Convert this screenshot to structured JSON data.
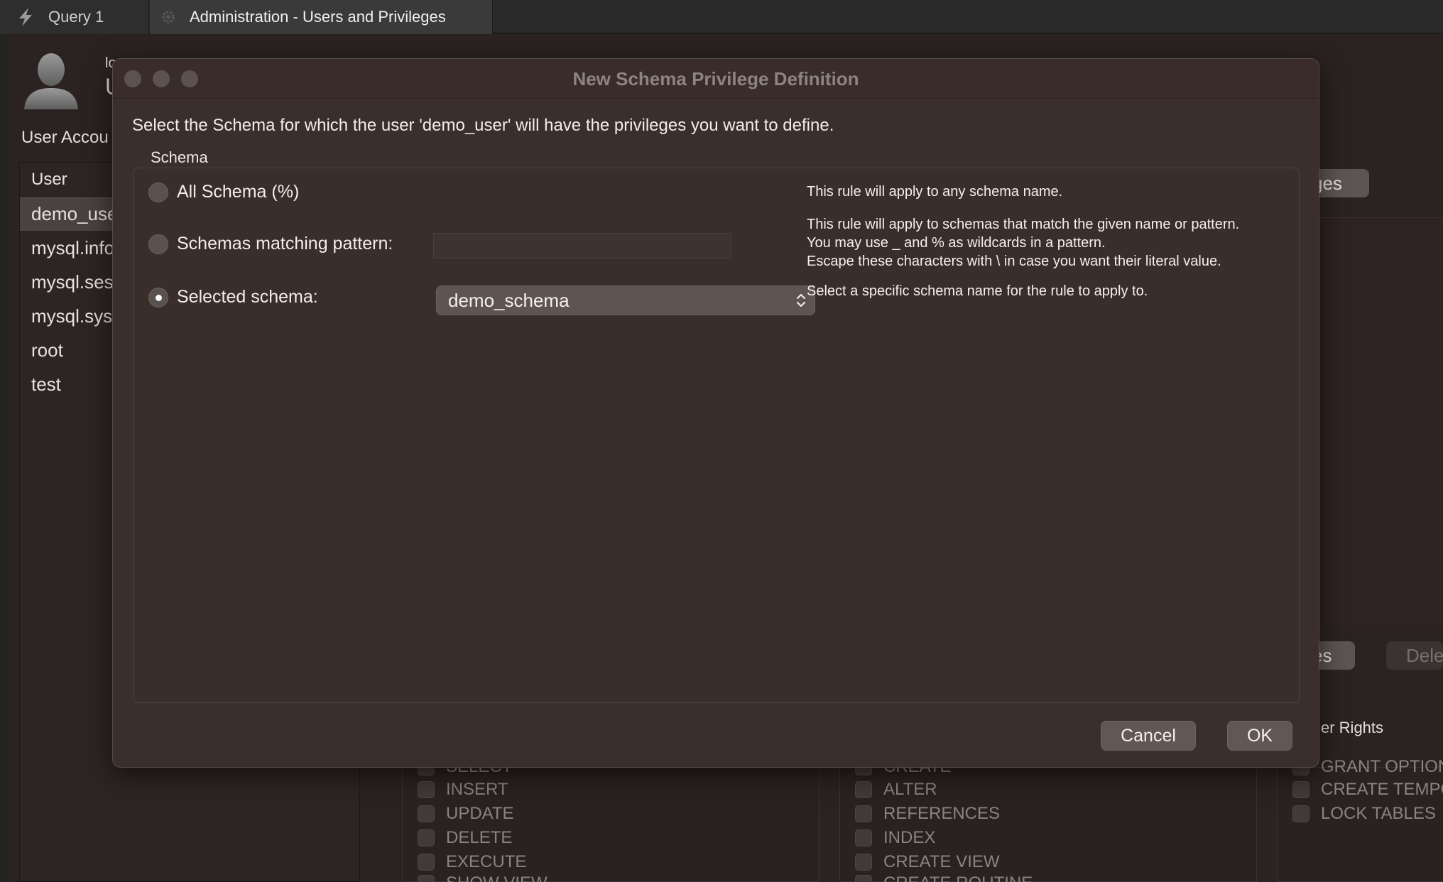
{
  "tabs": [
    {
      "label": "Query 1"
    },
    {
      "label": "Administration - Users and Privileges"
    }
  ],
  "background": {
    "login_label_partial": "lo",
    "login_value_partial": "U",
    "section_label_partial": "User Accou",
    "user_list": {
      "header": "User",
      "rows": [
        "demo_use",
        "mysql.info",
        "mysql.ses",
        "mysql.sys",
        "root",
        "test"
      ],
      "selected_index": 0
    },
    "tab_partial": "ges",
    "revoke_button_partial": "es",
    "delete_button_partial": "Dele",
    "other_rights_partial": "er Rights",
    "object_rights": [
      "SELECT",
      "INSERT",
      "UPDATE",
      "DELETE",
      "EXECUTE",
      "SHOW VIEW"
    ],
    "ddl_rights": [
      "CREATE",
      "ALTER",
      "REFERENCES",
      "INDEX",
      "CREATE VIEW",
      "CREATE ROUTINE"
    ],
    "other_rights": [
      "GRANT OPTION",
      "CREATE TEMPO",
      "LOCK TABLES"
    ]
  },
  "dialog": {
    "title": "New Schema Privilege Definition",
    "instruction": "Select the Schema for which the user 'demo_user' will have the privileges you want to define.",
    "group_label": "Schema",
    "options": {
      "all": {
        "label": "All Schema (%)",
        "selected": false,
        "description": "This rule will apply to any schema name."
      },
      "pattern": {
        "label": "Schemas matching pattern:",
        "selected": false,
        "value": "",
        "description_lines": [
          "This rule will apply to schemas that match the given name or pattern.",
          "You may use _ and % as wildcards in a pattern.",
          "Escape these characters with \\ in case you want their literal value."
        ]
      },
      "selected": {
        "label": "Selected schema:",
        "selected": true,
        "value": "demo_schema",
        "description": "Select a specific schema name for the rule to apply to."
      }
    },
    "buttons": {
      "cancel": "Cancel",
      "ok": "OK"
    }
  },
  "colors": {
    "dialog_bg": "#3b2f2c",
    "window_bg": "#2b2321",
    "button_bg": "#615754",
    "title_text": "#8d8480"
  },
  "icons": {
    "tab1": "lightning-bolt-icon",
    "tab2": "gear-icon",
    "avatar": "user-silhouette-icon",
    "select_chevron": "up-down-chevron-icon"
  }
}
